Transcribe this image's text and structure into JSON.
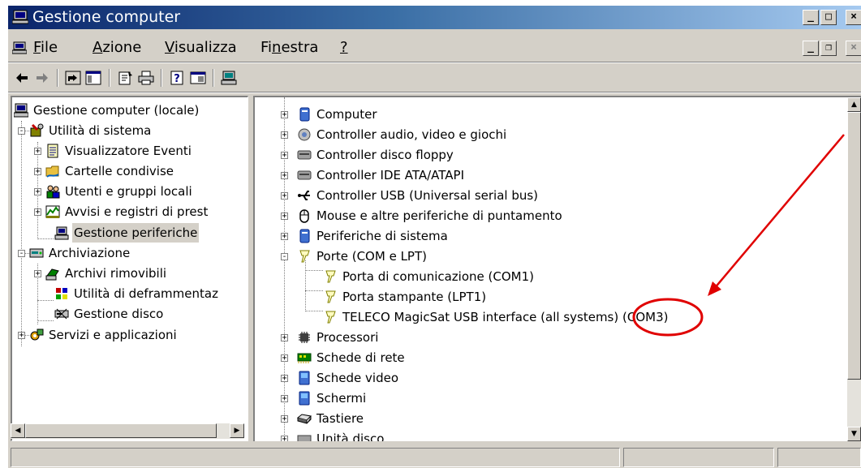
{
  "window": {
    "title": "Gestione computer",
    "caption_buttons": [
      "minimize",
      "maximize",
      "close"
    ],
    "mdi_buttons": [
      "restore",
      "close"
    ]
  },
  "menubar": {
    "items": [
      {
        "label": "File",
        "access_key": "F"
      },
      {
        "label": "Azione",
        "access_key": "A"
      },
      {
        "label": "Visualizza",
        "access_key": "V"
      },
      {
        "label": "Finestra",
        "access_key": "n"
      },
      {
        "label": "?",
        "access_key": "?"
      }
    ]
  },
  "toolbar": {
    "buttons": [
      "back-icon",
      "forward-icon",
      "up-folder-icon",
      "show-hide-tree-icon",
      "properties-icon",
      "print-icon",
      "help-icon",
      "view-icon",
      "computer-icon"
    ]
  },
  "tree": {
    "root": "Gestione computer (locale)",
    "items": [
      {
        "label": "Utilità di sistema",
        "icon": "tools-icon",
        "level": 1,
        "expander": "-"
      },
      {
        "label": "Visualizzatore Eventi",
        "icon": "event-viewer-icon",
        "level": 2,
        "expander": "+"
      },
      {
        "label": "Cartelle condivise",
        "icon": "shared-folder-icon",
        "level": 2,
        "expander": "+"
      },
      {
        "label": "Utenti e gruppi locali",
        "icon": "users-icon",
        "level": 2,
        "expander": "+"
      },
      {
        "label": "Avvisi e registri di prest",
        "icon": "performance-logs-icon",
        "level": 2,
        "expander": "+"
      },
      {
        "label": "Gestione periferiche",
        "icon": "device-manager-icon",
        "level": 2,
        "expander": "",
        "selected": true
      },
      {
        "label": "Archiviazione",
        "icon": "storage-icon",
        "level": 1,
        "expander": "-"
      },
      {
        "label": "Archivi rimovibili",
        "icon": "removable-storage-icon",
        "level": 2,
        "expander": "+"
      },
      {
        "label": "Utilità di deframmentaz",
        "icon": "defrag-icon",
        "level": 2,
        "expander": ""
      },
      {
        "label": "Gestione disco",
        "icon": "disk-management-icon",
        "level": 2,
        "expander": ""
      },
      {
        "label": "Servizi e applicazioni",
        "icon": "services-icon",
        "level": 1,
        "expander": "+"
      }
    ]
  },
  "devices": {
    "items": [
      {
        "label": "Computer",
        "icon": "computer-icon",
        "expander": "+",
        "level": 0
      },
      {
        "label": "Controller audio, video e giochi",
        "icon": "audio-icon",
        "expander": "+",
        "level": 0
      },
      {
        "label": "Controller disco floppy",
        "icon": "floppy-controller-icon",
        "expander": "+",
        "level": 0
      },
      {
        "label": "Controller IDE ATA/ATAPI",
        "icon": "ide-controller-icon",
        "expander": "+",
        "level": 0
      },
      {
        "label": "Controller USB (Universal serial bus)",
        "icon": "usb-icon",
        "expander": "+",
        "level": 0
      },
      {
        "label": "Mouse e altre periferiche di puntamento",
        "icon": "mouse-icon",
        "expander": "+",
        "level": 0
      },
      {
        "label": "Periferiche di sistema",
        "icon": "system-device-icon",
        "expander": "+",
        "level": 0
      },
      {
        "label": "Porte (COM e LPT)",
        "icon": "port-icon",
        "expander": "-",
        "level": 0
      },
      {
        "label": "Porta di comunicazione (COM1)",
        "icon": "port-icon",
        "expander": "",
        "level": 1
      },
      {
        "label": "Porta stampante (LPT1)",
        "icon": "port-icon",
        "expander": "",
        "level": 1
      },
      {
        "label": "TELECO MagicSat USB interface (all systems) (COM3)",
        "icon": "port-icon",
        "expander": "",
        "level": 1
      },
      {
        "label": "Processori",
        "icon": "processor-icon",
        "expander": "+",
        "level": 0
      },
      {
        "label": "Schede di rete",
        "icon": "network-card-icon",
        "expander": "+",
        "level": 0
      },
      {
        "label": "Schede video",
        "icon": "display-adapter-icon",
        "expander": "+",
        "level": 0
      },
      {
        "label": "Schermi",
        "icon": "monitor-icon",
        "expander": "+",
        "level": 0
      },
      {
        "label": "Tastiere",
        "icon": "keyboard-icon",
        "expander": "+",
        "level": 0
      },
      {
        "label": "Unità disco",
        "icon": "disk-drive-icon",
        "expander": "+",
        "level": 0
      }
    ]
  },
  "annotation": {
    "color": "#e00000",
    "target": "COM3"
  }
}
